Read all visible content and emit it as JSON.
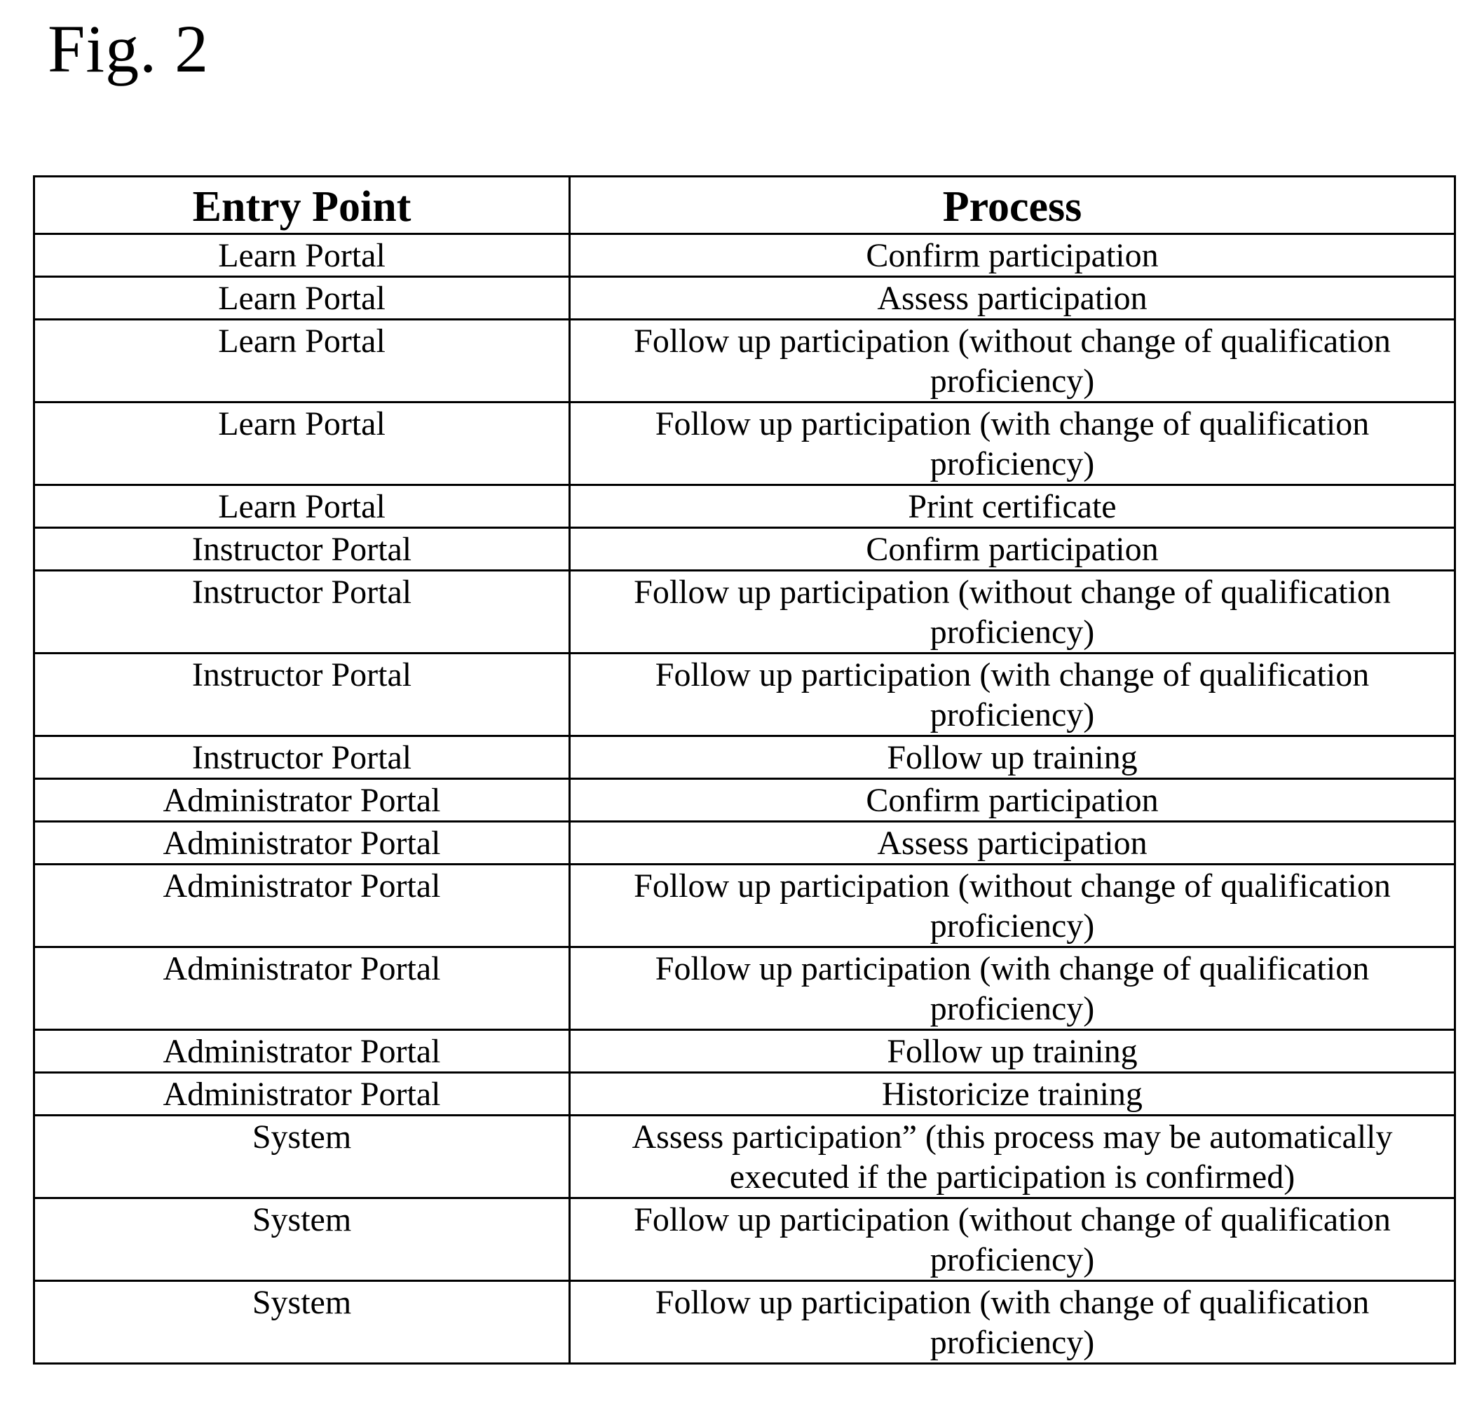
{
  "figure": {
    "title": "Fig. 2"
  },
  "table": {
    "headers": [
      "Entry Point",
      "Process"
    ],
    "rows": [
      {
        "entry_point": "Learn Portal",
        "process": "Confirm participation",
        "lines": 1
      },
      {
        "entry_point": "Learn Portal",
        "process": "Assess participation",
        "lines": 1
      },
      {
        "entry_point": "Learn Portal",
        "process": "Follow up participation (without change of qualification proficiency)",
        "lines": 2
      },
      {
        "entry_point": "Learn Portal",
        "process": "Follow up participation (with change of qualification proficiency)",
        "lines": 2
      },
      {
        "entry_point": "Learn Portal",
        "process": "Print certificate",
        "lines": 1
      },
      {
        "entry_point": "Instructor Portal",
        "process": "Confirm participation",
        "lines": 1
      },
      {
        "entry_point": "Instructor Portal",
        "process": "Follow up participation (without change of qualification proficiency)",
        "lines": 2
      },
      {
        "entry_point": "Instructor Portal",
        "process": "Follow up participation (with change of qualification proficiency)",
        "lines": 2
      },
      {
        "entry_point": "Instructor Portal",
        "process": "Follow up training",
        "lines": 1
      },
      {
        "entry_point": "Administrator Portal",
        "process": "Confirm participation",
        "lines": 1
      },
      {
        "entry_point": "Administrator Portal",
        "process": "Assess participation",
        "lines": 1
      },
      {
        "entry_point": "Administrator Portal",
        "process": "Follow up participation (without change of qualification proficiency)",
        "lines": 2
      },
      {
        "entry_point": "Administrator Portal",
        "process": "Follow up participation (with change of qualification proficiency)",
        "lines": 2
      },
      {
        "entry_point": "Administrator Portal",
        "process": "Follow up training",
        "lines": 1
      },
      {
        "entry_point": "Administrator Portal",
        "process": "Historicize training",
        "lines": 1
      },
      {
        "entry_point": "System",
        "process": "Assess participation” (this process may be automatically executed if the participation is confirmed)",
        "lines": 2
      },
      {
        "entry_point": "System",
        "process": "Follow up participation (without change of qualification proficiency)",
        "lines": 2
      },
      {
        "entry_point": "System",
        "process": "Follow up participation (with change of qualification proficiency)",
        "lines": 2
      }
    ]
  }
}
